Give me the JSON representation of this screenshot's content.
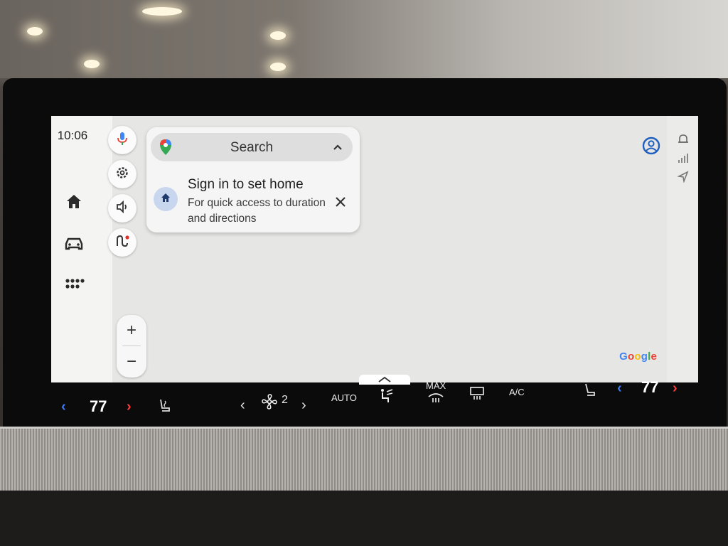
{
  "status": {
    "time": "10:06"
  },
  "search": {
    "label": "Search"
  },
  "signin": {
    "title": "Sign in to set home",
    "subtitle": "For quick access to duration and directions"
  },
  "zoom": {
    "in_label": "+",
    "out_label": "−"
  },
  "attribution": {
    "letters": [
      {
        "ch": "G",
        "color": "#4285F4"
      },
      {
        "ch": "o",
        "color": "#EA4335"
      },
      {
        "ch": "o",
        "color": "#FBBC05"
      },
      {
        "ch": "g",
        "color": "#4285F4"
      },
      {
        "ch": "l",
        "color": "#34A853"
      },
      {
        "ch": "e",
        "color": "#EA4335"
      }
    ]
  },
  "climate": {
    "driver_temp": "77",
    "passenger_temp": "77",
    "fan_speed": "2",
    "auto_label": "AUTO",
    "max_label": "MAX",
    "ac_label": "A/C"
  },
  "colors": {
    "accent_blue": "#3b7bff",
    "accent_red": "#ff3b3b",
    "home_chip": "#c8d6ee"
  }
}
